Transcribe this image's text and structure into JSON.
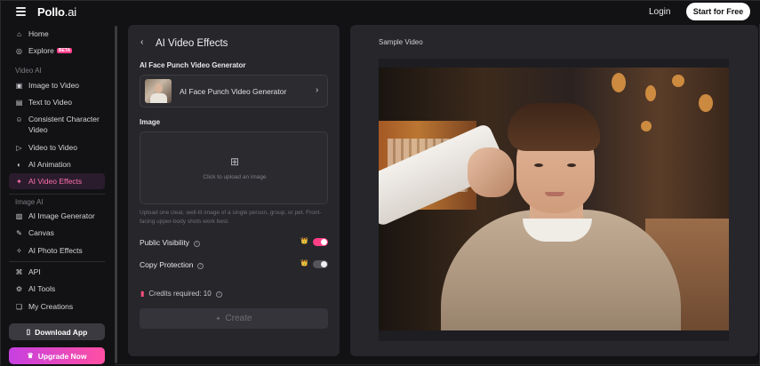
{
  "topbar": {
    "logo_main": "Pollo",
    "logo_ai": ".ai",
    "login_label": "Login",
    "start_label": "Start for Free"
  },
  "sidebar": {
    "items_top": [
      {
        "label": "Home",
        "icon": "home-icon"
      },
      {
        "label": "Explore",
        "icon": "compass-icon",
        "badge": "BETA"
      }
    ],
    "section_video": "Video AI",
    "items_video": [
      {
        "label": "Image to Video",
        "icon": "image-video-icon"
      },
      {
        "label": "Text to Video",
        "icon": "text-video-icon"
      },
      {
        "label": "Consistent Character Video",
        "icon": "character-icon"
      },
      {
        "label": "Video to Video",
        "icon": "video-video-icon"
      },
      {
        "label": "AI Animation",
        "icon": "animation-icon"
      },
      {
        "label": "AI Video Effects",
        "icon": "effects-icon",
        "active": true
      }
    ],
    "section_image": "Image AI",
    "items_image": [
      {
        "label": "AI Image Generator",
        "icon": "image-generator-icon"
      },
      {
        "label": "Canvas",
        "icon": "canvas-icon"
      },
      {
        "label": "AI Photo Effects",
        "icon": "photo-effects-icon"
      }
    ],
    "items_bottom": [
      {
        "label": "API",
        "icon": "api-icon"
      },
      {
        "label": "AI Tools",
        "icon": "tools-icon"
      },
      {
        "label": "My Creations",
        "icon": "creations-icon"
      }
    ],
    "download_label": "Download App",
    "upgrade_label": "Upgrade Now"
  },
  "panel": {
    "title": "AI Video Effects",
    "generator_section_label": "AI Face Punch Video Generator",
    "generator_selected": "AI Face Punch Video Generator",
    "image_label": "Image",
    "upload_placeholder": "Click to upload an image",
    "hint_text": "Upload one clear, well-lit image of a single person, group, or pet. Front-facing upper-body shots work best.",
    "public_visibility_label": "Public Visibility",
    "public_visibility_on": true,
    "copy_protection_label": "Copy Protection",
    "copy_protection_on": false,
    "credits_text": "Credits required: 10",
    "create_label": "Create"
  },
  "preview": {
    "label": "Sample Video"
  },
  "colors": {
    "accent": "#ff3f86",
    "active_text": "#ff6fb1",
    "upgrade_gradient_start": "#c640e0",
    "upgrade_gradient_end": "#ff4fa3",
    "panel_bg": "#26262b",
    "page_bg": "#121214"
  }
}
